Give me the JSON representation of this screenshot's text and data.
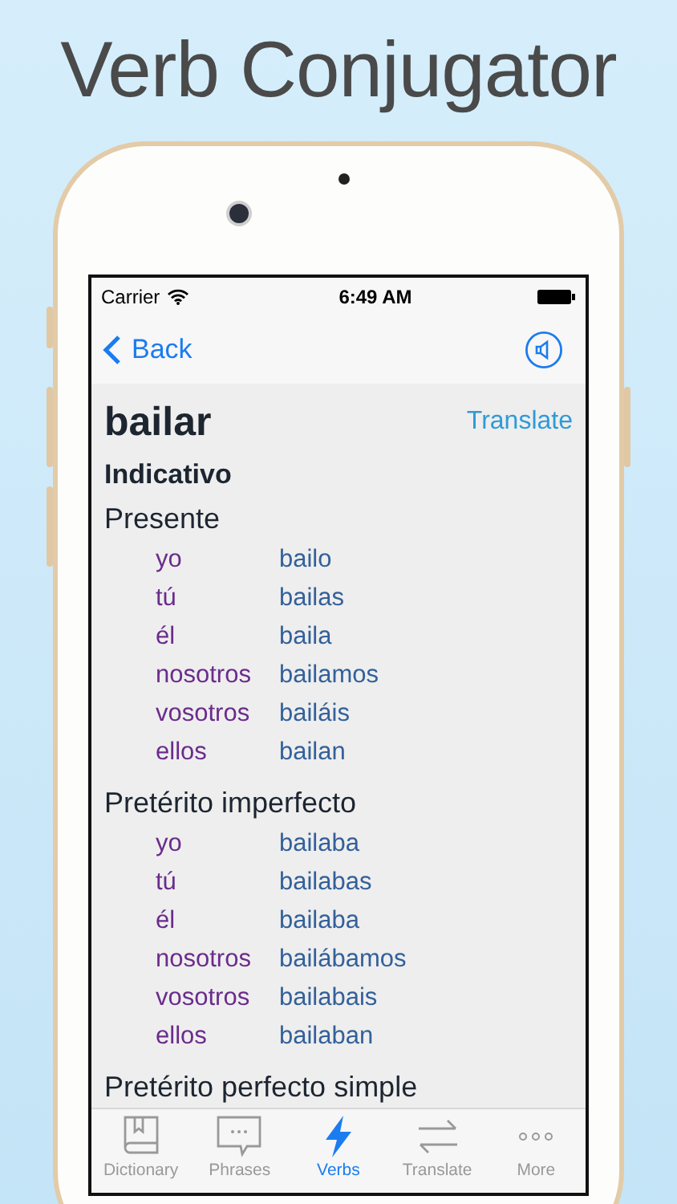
{
  "title": "Verb Conjugator",
  "status_bar": {
    "carrier": "Carrier",
    "time": "6:49 AM"
  },
  "nav": {
    "back": "Back"
  },
  "verb": "bailar",
  "translate": "Translate",
  "mood": "Indicativo",
  "tenses": [
    {
      "name": "Presente",
      "forms": [
        {
          "pronoun": "yo",
          "form": "bailo"
        },
        {
          "pronoun": "tú",
          "form": "bailas"
        },
        {
          "pronoun": "él",
          "form": "baila"
        },
        {
          "pronoun": "nosotros",
          "form": "bailamos"
        },
        {
          "pronoun": "vosotros",
          "form": "bailáis"
        },
        {
          "pronoun": "ellos",
          "form": "bailan"
        }
      ]
    },
    {
      "name": "Pretérito imperfecto",
      "forms": [
        {
          "pronoun": "yo",
          "form": "bailaba"
        },
        {
          "pronoun": "tú",
          "form": "bailabas"
        },
        {
          "pronoun": "él",
          "form": "bailaba"
        },
        {
          "pronoun": "nosotros",
          "form": "bailábamos"
        },
        {
          "pronoun": "vosotros",
          "form": "bailabais"
        },
        {
          "pronoun": "ellos",
          "form": "bailaban"
        }
      ]
    },
    {
      "name": "Pretérito perfecto simple"
    }
  ],
  "tab_bar": [
    {
      "label": "Dictionary",
      "kind": "book",
      "selected": false
    },
    {
      "label": "Phrases",
      "kind": "speech",
      "selected": false
    },
    {
      "label": "Verbs",
      "kind": "bolt",
      "selected": true
    },
    {
      "label": "Translate",
      "kind": "arrows",
      "selected": false
    },
    {
      "label": "More",
      "kind": "dots",
      "selected": false
    }
  ]
}
